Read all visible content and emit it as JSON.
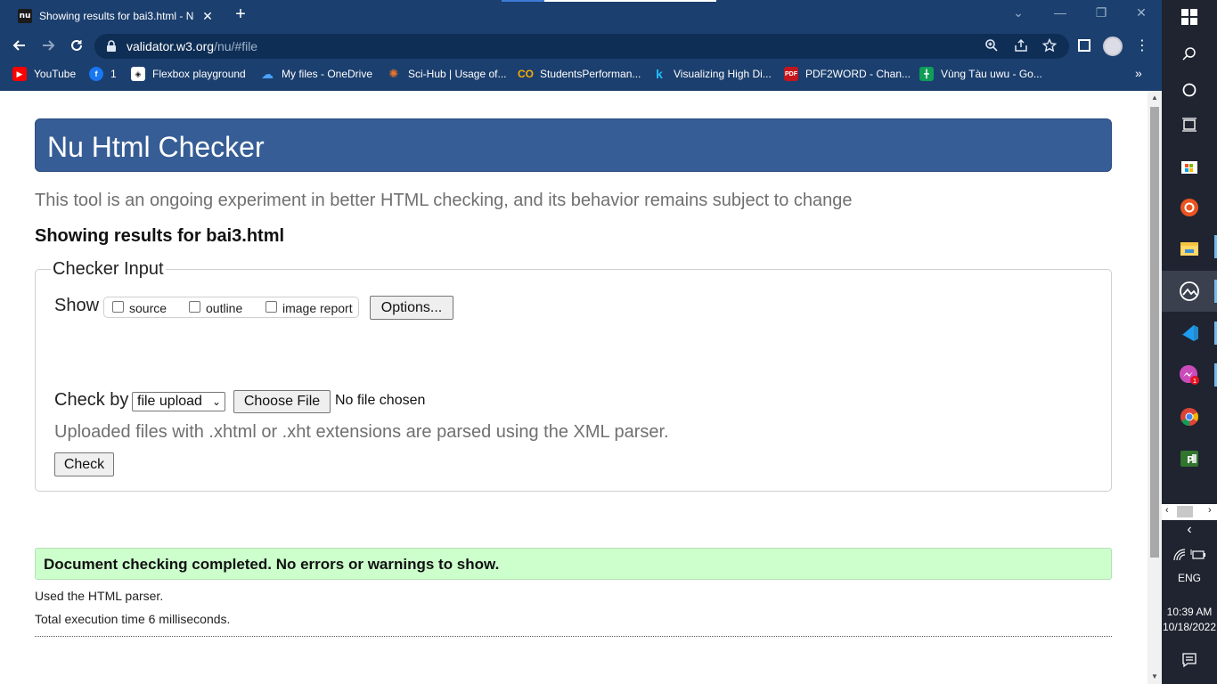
{
  "browser": {
    "tab": {
      "favicon": "nu",
      "title": "Showing results for bai3.html - N",
      "close": "✕"
    },
    "new_tab": "+",
    "url": {
      "host": "validator.w3.org",
      "path": "/nu/#file"
    },
    "bookmarks": [
      {
        "label": "YouTube",
        "icon": "youtube-icon",
        "color": "#ff0000"
      },
      {
        "label": "1",
        "icon": "facebook-icon",
        "color": "#1877f2"
      },
      {
        "label": "Flexbox playground",
        "icon": "flexbox-icon",
        "color": "#ffffff"
      },
      {
        "label": "My files - OneDrive",
        "icon": "onedrive-icon",
        "color": "#2b7cd3"
      },
      {
        "label": "Sci-Hub | Usage of...",
        "icon": "scihub-icon",
        "color": "#e8742a"
      },
      {
        "label": "StudentsPerforman...",
        "icon": "colab-icon",
        "color": "#f9ab00"
      },
      {
        "label": "Visualizing High Di...",
        "icon": "k-icon",
        "color": "#20beff"
      },
      {
        "label": "PDF2WORD - Chan...",
        "icon": "pdf-icon",
        "color": "#c4161c"
      },
      {
        "label": "Vùng Tàu uwu - Go...",
        "icon": "sheets-icon",
        "color": "#0f9d58"
      }
    ]
  },
  "page": {
    "title": "Nu Html Checker",
    "subtitle": "This tool is an ongoing experiment in better HTML checking, and its behavior remains subject to change",
    "results_for": "Showing results for bai3.html",
    "fieldset_legend": "Checker Input",
    "show_label": "Show",
    "show_options": [
      "source",
      "outline",
      "image report"
    ],
    "options_button": "Options...",
    "check_by_label": "Check by",
    "check_by_value": "file upload",
    "choose_file_button": "Choose File",
    "no_file": "No file chosen",
    "upload_note": "Uploaded files with .xhtml or .xht extensions are parsed using the XML parser.",
    "check_button": "Check",
    "success_message": "Document checking completed. No errors or warnings to show.",
    "parser_info": "Used the HTML parser.",
    "execution_info": "Total execution time 6 milliseconds."
  },
  "taskbar": {
    "language": "ENG",
    "time": "10:39 AM",
    "date": "10/18/2022",
    "messenger_badge": "1"
  },
  "colors": {
    "chrome": "#1b3f6e",
    "header": "#365d95",
    "success_bg": "#ccffcc"
  }
}
